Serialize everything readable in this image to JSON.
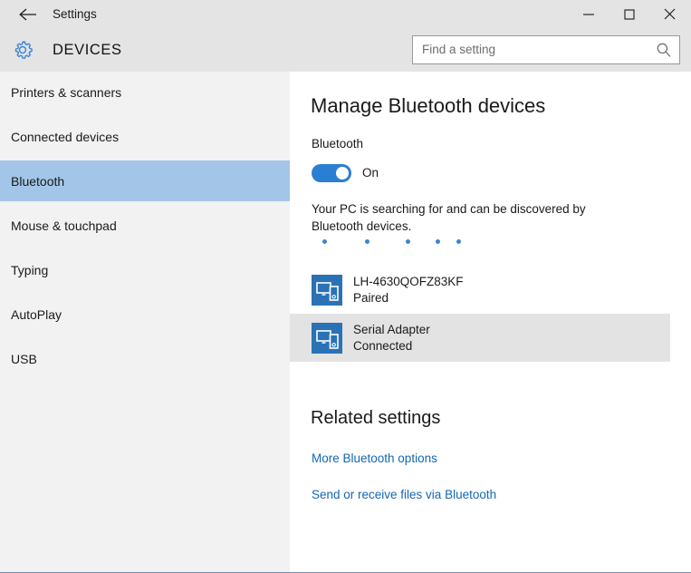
{
  "window": {
    "title": "Settings",
    "back_icon": "back-arrow-icon",
    "minimize_label": "—",
    "maximize_label": "□",
    "close_label": "✕"
  },
  "header": {
    "gear_icon": "gear-icon",
    "page_title": "DEVICES",
    "search": {
      "placeholder": "Find a setting",
      "value": "",
      "icon": "search-icon"
    }
  },
  "sidebar": {
    "items": [
      {
        "label": "Printers & scanners",
        "selected": false
      },
      {
        "label": "Connected devices",
        "selected": false
      },
      {
        "label": "Bluetooth",
        "selected": true
      },
      {
        "label": "Mouse & touchpad",
        "selected": false
      },
      {
        "label": "Typing",
        "selected": false
      },
      {
        "label": "AutoPlay",
        "selected": false
      },
      {
        "label": "USB",
        "selected": false
      }
    ]
  },
  "main": {
    "heading": "Manage Bluetooth devices",
    "toggle": {
      "label": "Bluetooth",
      "state_text": "On",
      "on": true
    },
    "status_text": "Your PC is searching for and can be discovered by Bluetooth devices.",
    "progress_dots": 5,
    "devices": [
      {
        "name": "LH-4630QOFZ83KF",
        "status": "Paired",
        "icon": "devices-pair-icon",
        "highlighted": false
      },
      {
        "name": "Serial Adapter",
        "status": "Connected",
        "icon": "devices-pair-icon",
        "highlighted": true
      }
    ],
    "related": {
      "heading": "Related settings",
      "links": [
        "More Bluetooth options",
        "Send or receive files via Bluetooth"
      ]
    }
  },
  "colors": {
    "accent": "#2a7fd4",
    "selection": "#a3c6e8",
    "link": "#1267b5",
    "sidebar_bg": "#f2f2f2",
    "titlebar_bg": "#e4e4e4",
    "device_icon_bg": "#2a72b5",
    "row_highlight": "#e3e3e3"
  }
}
